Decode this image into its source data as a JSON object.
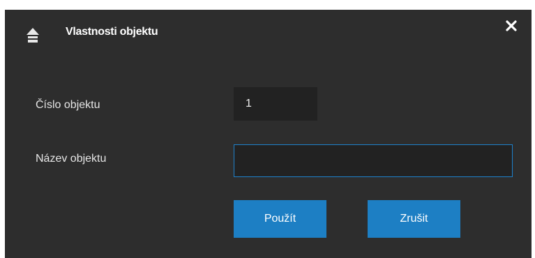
{
  "dialog": {
    "title": "Vlastnosti objektu",
    "title_icon": "up-arrow-home-icon",
    "close_icon": "close-icon"
  },
  "fields": {
    "number_label": "Číslo objektu",
    "number_value": "1",
    "name_label": "Název objektu",
    "name_value": ""
  },
  "buttons": {
    "apply_label": "Použít",
    "cancel_label": "Zrušit"
  },
  "colors": {
    "background": "#2d2d2d",
    "field_background": "#222222",
    "accent": "#1d7fc4",
    "focus_border": "#1e82cc"
  }
}
